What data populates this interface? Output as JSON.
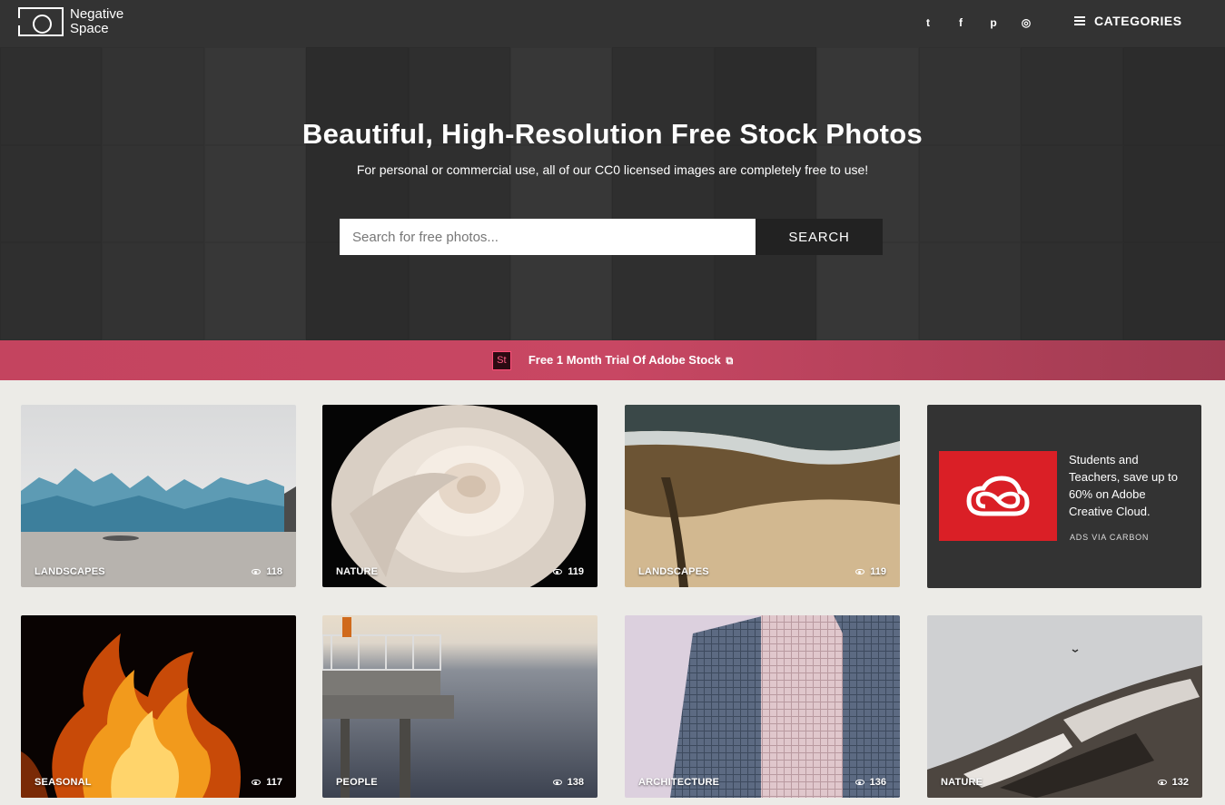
{
  "header": {
    "logo_line1": "Negative",
    "logo_line2": "Space",
    "social": [
      {
        "icon": "twitter-icon",
        "glyph": "t"
      },
      {
        "icon": "facebook-icon",
        "glyph": "f"
      },
      {
        "icon": "pinterest-icon",
        "glyph": "p"
      },
      {
        "icon": "instagram-icon",
        "glyph": "◎"
      }
    ],
    "categories_label": "CATEGORIES"
  },
  "hero": {
    "title": "Beautiful, High-Resolution Free Stock Photos",
    "subtitle": "For personal or commercial use, all of our CC0 licensed images are completely free to use!",
    "search_placeholder": "Search for free photos...",
    "search_button": "SEARCH"
  },
  "promo": {
    "badge": "St",
    "text": "Free 1 Month Trial Of Adobe Stock"
  },
  "cards_row1": [
    {
      "category": "LANDSCAPES",
      "views": "118"
    },
    {
      "category": "NATURE",
      "views": "119"
    },
    {
      "category": "LANDSCAPES",
      "views": "119"
    }
  ],
  "ad": {
    "text": "Students and Teachers, save up to 60% on Adobe Creative Cloud.",
    "via": "ADS VIA CARBON"
  },
  "cards_row2": [
    {
      "category": "SEASONAL",
      "views": "117"
    },
    {
      "category": "PEOPLE",
      "views": "138"
    },
    {
      "category": "ARCHITECTURE",
      "views": "136"
    },
    {
      "category": "NATURE",
      "views": "132"
    }
  ],
  "colors": {
    "header_bg": "#333333",
    "promo_pink": "#c84763",
    "page_bg": "#ecebe7",
    "adobe_red": "#da1f26"
  }
}
